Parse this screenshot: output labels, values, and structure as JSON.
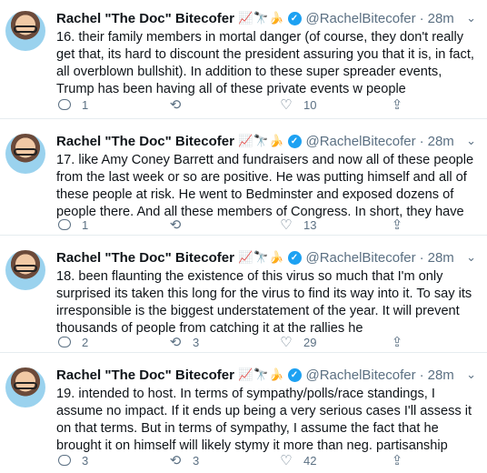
{
  "tweets": [
    {
      "name": "Rachel \"The Doc\" Bitecofer",
      "emoji": "📈🔭🍌",
      "handle": "@RachelBitecofer",
      "time": "28m",
      "text": "16. their family members in mortal danger (of course, they don't really get that, its hard to discount the president assuring you that it is, in fact, all overblown bullshit). In addition to these super spreader events, Trump has been having all of these private events w people",
      "replies": "1",
      "retweets": "",
      "likes": "10"
    },
    {
      "name": "Rachel \"The Doc\" Bitecofer",
      "emoji": "📈🔭🍌",
      "handle": "@RachelBitecofer",
      "time": "28m",
      "text": "17. like Amy Coney Barrett and fundraisers and now all of these people from the last week or so are positive. He was putting himself and all of these people at risk. He went to Bedminster and exposed dozens of people there. And all these members of Congress. In short, they have",
      "replies": "1",
      "retweets": "",
      "likes": "13"
    },
    {
      "name": "Rachel \"The Doc\" Bitecofer",
      "emoji": "📈🔭🍌",
      "handle": "@RachelBitecofer",
      "time": "28m",
      "text": "18. been flaunting the existence of this virus so much that I'm only surprised its taken this long for the virus to find its way into it. To say its irresponsible is the biggest understatement of the year. It will prevent thousands of people from catching it at the rallies he",
      "replies": "2",
      "retweets": "3",
      "likes": "29"
    },
    {
      "name": "Rachel \"The Doc\" Bitecofer",
      "emoji": "📈🔭🍌",
      "handle": "@RachelBitecofer",
      "time": "28m",
      "text": "19. intended to host. In terms of sympathy/polls/race standings, I assume no impact. If it ends up being a very serious cases I'll assess it on that terms. But in terms of sympathy, I assume the fact that he brought it on himself will likely stymy it more than neg. partisanship",
      "replies": "3",
      "retweets": "3",
      "likes": "42"
    }
  ],
  "icons": {
    "caret": "chevron-down-icon",
    "verified": "verified-badge-icon",
    "reply": "reply-icon",
    "retweet": "retweet-icon",
    "like": "heart-icon"
  },
  "colors": {
    "verified": "#1da1f2",
    "secondary_text": "#5b7083",
    "divider": "#e6ecf0"
  }
}
